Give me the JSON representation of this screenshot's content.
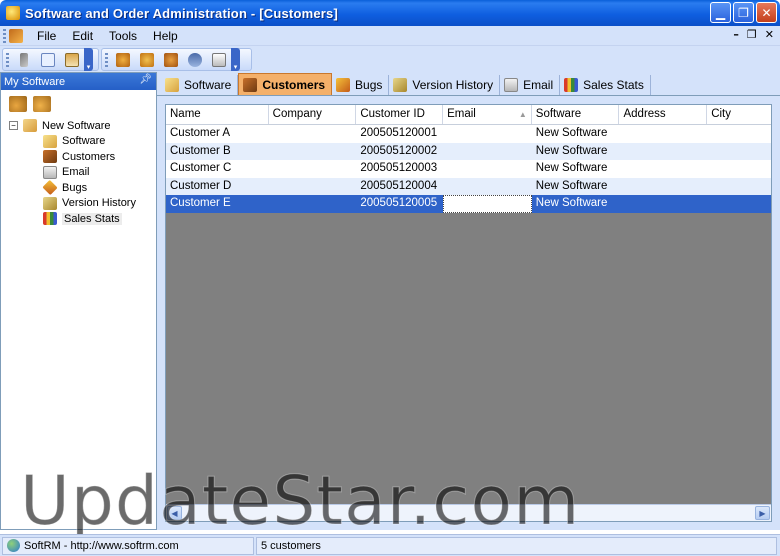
{
  "window": {
    "title": "Software and Order Administration - [Customers]"
  },
  "menubar": {
    "items": [
      "File",
      "Edit",
      "Tools",
      "Help"
    ]
  },
  "toolbar": {
    "icons": [
      "cut-icon",
      "copy-icon",
      "paste-icon",
      "add-user-icon",
      "remove-user-icon",
      "edit-user-icon",
      "find-icon",
      "print-icon"
    ]
  },
  "left_panel": {
    "title": "My Software",
    "root": "New Software",
    "items": [
      {
        "label": "Software",
        "icon": "software-icon"
      },
      {
        "label": "Customers",
        "icon": "customers-icon"
      },
      {
        "label": "Email",
        "icon": "email-icon"
      },
      {
        "label": "Bugs",
        "icon": "bugs-icon"
      },
      {
        "label": "Version History",
        "icon": "version-history-icon"
      },
      {
        "label": "Sales Stats",
        "icon": "sales-stats-icon"
      }
    ],
    "selected": "Sales Stats"
  },
  "tabs": [
    {
      "label": "Software",
      "active": false
    },
    {
      "label": "Customers",
      "active": true
    },
    {
      "label": "Bugs",
      "active": false
    },
    {
      "label": "Version History",
      "active": false
    },
    {
      "label": "Email",
      "active": false
    },
    {
      "label": "Sales Stats",
      "active": false
    }
  ],
  "grid": {
    "columns": [
      "Name",
      "Company",
      "Customer ID",
      "Email",
      "Software",
      "Address",
      "City"
    ],
    "sorted_column": "Email",
    "rows": [
      [
        "Customer A",
        "",
        "200505120001",
        "",
        "New Software",
        "",
        ""
      ],
      [
        "Customer B",
        "",
        "200505120002",
        "",
        "New Software",
        "",
        ""
      ],
      [
        "Customer C",
        "",
        "200505120003",
        "",
        "New Software",
        "",
        ""
      ],
      [
        "Customer D",
        "",
        "200505120004",
        "",
        "New Software",
        "",
        ""
      ],
      [
        "Customer E",
        "",
        "200505120005",
        "",
        "New Software",
        "",
        ""
      ]
    ],
    "selected_row": 4
  },
  "statusbar": {
    "link": "SoftRM - http://www.softrm.com",
    "count": "5 customers"
  },
  "watermark": "UpdateStar.com",
  "colors": {
    "titlebar": "#0b53d1",
    "chrome": "#d4e2fa",
    "selection": "#2f63c9",
    "active_tab": "#f4b06a",
    "grid_empty": "#808080"
  }
}
